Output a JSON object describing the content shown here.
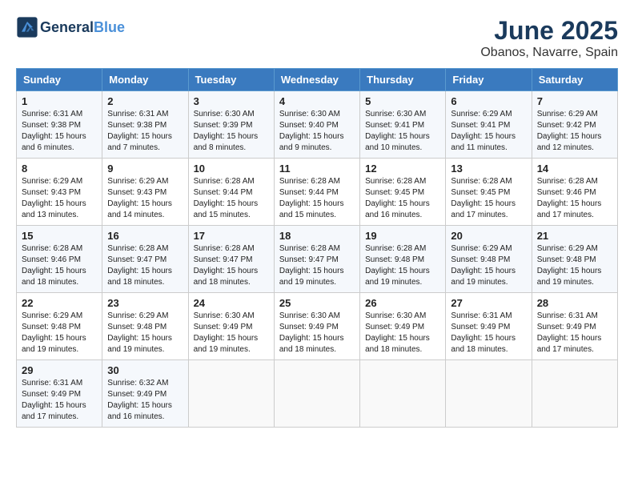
{
  "header": {
    "logo_line1": "General",
    "logo_line2": "Blue",
    "month_title": "June 2025",
    "subtitle": "Obanos, Navarre, Spain"
  },
  "days_of_week": [
    "Sunday",
    "Monday",
    "Tuesday",
    "Wednesday",
    "Thursday",
    "Friday",
    "Saturday"
  ],
  "weeks": [
    [
      {
        "day": "1",
        "sunrise": "Sunrise: 6:31 AM",
        "sunset": "Sunset: 9:38 PM",
        "daylight": "Daylight: 15 hours and 6 minutes."
      },
      {
        "day": "2",
        "sunrise": "Sunrise: 6:31 AM",
        "sunset": "Sunset: 9:38 PM",
        "daylight": "Daylight: 15 hours and 7 minutes."
      },
      {
        "day": "3",
        "sunrise": "Sunrise: 6:30 AM",
        "sunset": "Sunset: 9:39 PM",
        "daylight": "Daylight: 15 hours and 8 minutes."
      },
      {
        "day": "4",
        "sunrise": "Sunrise: 6:30 AM",
        "sunset": "Sunset: 9:40 PM",
        "daylight": "Daylight: 15 hours and 9 minutes."
      },
      {
        "day": "5",
        "sunrise": "Sunrise: 6:30 AM",
        "sunset": "Sunset: 9:41 PM",
        "daylight": "Daylight: 15 hours and 10 minutes."
      },
      {
        "day": "6",
        "sunrise": "Sunrise: 6:29 AM",
        "sunset": "Sunset: 9:41 PM",
        "daylight": "Daylight: 15 hours and 11 minutes."
      },
      {
        "day": "7",
        "sunrise": "Sunrise: 6:29 AM",
        "sunset": "Sunset: 9:42 PM",
        "daylight": "Daylight: 15 hours and 12 minutes."
      }
    ],
    [
      {
        "day": "8",
        "sunrise": "Sunrise: 6:29 AM",
        "sunset": "Sunset: 9:43 PM",
        "daylight": "Daylight: 15 hours and 13 minutes."
      },
      {
        "day": "9",
        "sunrise": "Sunrise: 6:29 AM",
        "sunset": "Sunset: 9:43 PM",
        "daylight": "Daylight: 15 hours and 14 minutes."
      },
      {
        "day": "10",
        "sunrise": "Sunrise: 6:28 AM",
        "sunset": "Sunset: 9:44 PM",
        "daylight": "Daylight: 15 hours and 15 minutes."
      },
      {
        "day": "11",
        "sunrise": "Sunrise: 6:28 AM",
        "sunset": "Sunset: 9:44 PM",
        "daylight": "Daylight: 15 hours and 15 minutes."
      },
      {
        "day": "12",
        "sunrise": "Sunrise: 6:28 AM",
        "sunset": "Sunset: 9:45 PM",
        "daylight": "Daylight: 15 hours and 16 minutes."
      },
      {
        "day": "13",
        "sunrise": "Sunrise: 6:28 AM",
        "sunset": "Sunset: 9:45 PM",
        "daylight": "Daylight: 15 hours and 17 minutes."
      },
      {
        "day": "14",
        "sunrise": "Sunrise: 6:28 AM",
        "sunset": "Sunset: 9:46 PM",
        "daylight": "Daylight: 15 hours and 17 minutes."
      }
    ],
    [
      {
        "day": "15",
        "sunrise": "Sunrise: 6:28 AM",
        "sunset": "Sunset: 9:46 PM",
        "daylight": "Daylight: 15 hours and 18 minutes."
      },
      {
        "day": "16",
        "sunrise": "Sunrise: 6:28 AM",
        "sunset": "Sunset: 9:47 PM",
        "daylight": "Daylight: 15 hours and 18 minutes."
      },
      {
        "day": "17",
        "sunrise": "Sunrise: 6:28 AM",
        "sunset": "Sunset: 9:47 PM",
        "daylight": "Daylight: 15 hours and 18 minutes."
      },
      {
        "day": "18",
        "sunrise": "Sunrise: 6:28 AM",
        "sunset": "Sunset: 9:47 PM",
        "daylight": "Daylight: 15 hours and 19 minutes."
      },
      {
        "day": "19",
        "sunrise": "Sunrise: 6:28 AM",
        "sunset": "Sunset: 9:48 PM",
        "daylight": "Daylight: 15 hours and 19 minutes."
      },
      {
        "day": "20",
        "sunrise": "Sunrise: 6:29 AM",
        "sunset": "Sunset: 9:48 PM",
        "daylight": "Daylight: 15 hours and 19 minutes."
      },
      {
        "day": "21",
        "sunrise": "Sunrise: 6:29 AM",
        "sunset": "Sunset: 9:48 PM",
        "daylight": "Daylight: 15 hours and 19 minutes."
      }
    ],
    [
      {
        "day": "22",
        "sunrise": "Sunrise: 6:29 AM",
        "sunset": "Sunset: 9:48 PM",
        "daylight": "Daylight: 15 hours and 19 minutes."
      },
      {
        "day": "23",
        "sunrise": "Sunrise: 6:29 AM",
        "sunset": "Sunset: 9:48 PM",
        "daylight": "Daylight: 15 hours and 19 minutes."
      },
      {
        "day": "24",
        "sunrise": "Sunrise: 6:30 AM",
        "sunset": "Sunset: 9:49 PM",
        "daylight": "Daylight: 15 hours and 19 minutes."
      },
      {
        "day": "25",
        "sunrise": "Sunrise: 6:30 AM",
        "sunset": "Sunset: 9:49 PM",
        "daylight": "Daylight: 15 hours and 18 minutes."
      },
      {
        "day": "26",
        "sunrise": "Sunrise: 6:30 AM",
        "sunset": "Sunset: 9:49 PM",
        "daylight": "Daylight: 15 hours and 18 minutes."
      },
      {
        "day": "27",
        "sunrise": "Sunrise: 6:31 AM",
        "sunset": "Sunset: 9:49 PM",
        "daylight": "Daylight: 15 hours and 18 minutes."
      },
      {
        "day": "28",
        "sunrise": "Sunrise: 6:31 AM",
        "sunset": "Sunset: 9:49 PM",
        "daylight": "Daylight: 15 hours and 17 minutes."
      }
    ],
    [
      {
        "day": "29",
        "sunrise": "Sunrise: 6:31 AM",
        "sunset": "Sunset: 9:49 PM",
        "daylight": "Daylight: 15 hours and 17 minutes."
      },
      {
        "day": "30",
        "sunrise": "Sunrise: 6:32 AM",
        "sunset": "Sunset: 9:49 PM",
        "daylight": "Daylight: 15 hours and 16 minutes."
      },
      null,
      null,
      null,
      null,
      null
    ]
  ]
}
